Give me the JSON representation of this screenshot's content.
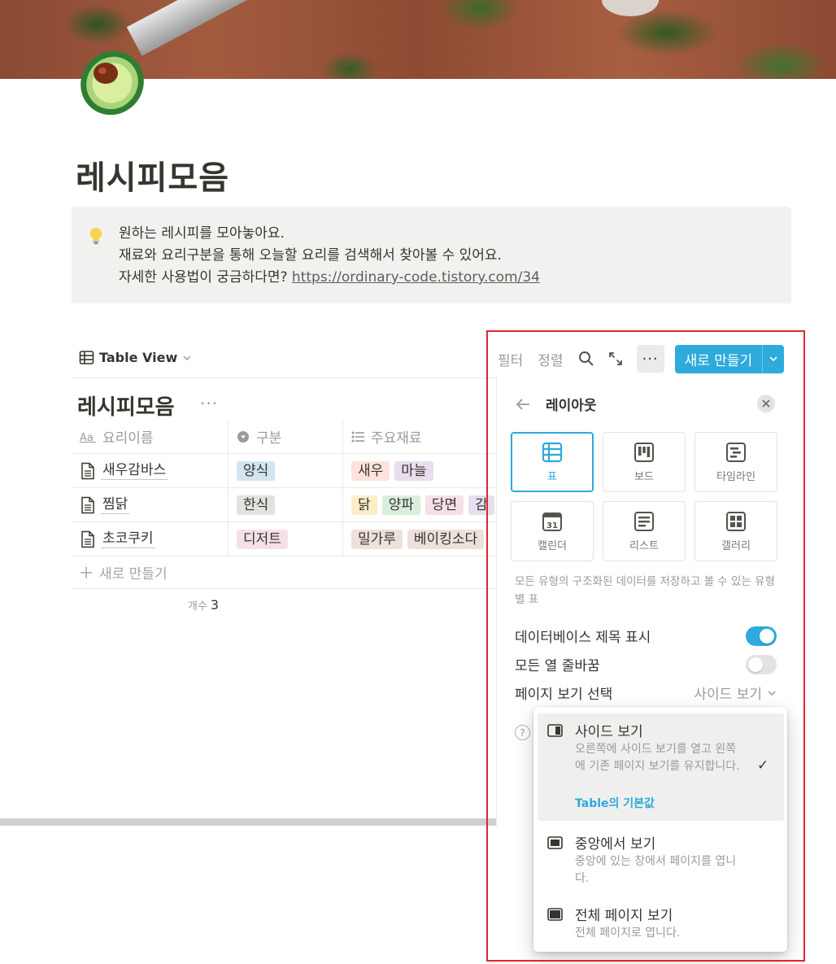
{
  "page": {
    "title": "레시피모음",
    "icon": "avocado-icon",
    "callout": {
      "icon": "lightbulb-icon",
      "line1": "원하는 레시피를 모아놓아요.",
      "line2": "재료와 요리구분을 통해 오늘할 요리를 검색해서 찾아볼 수 있어요.",
      "line3_prefix": "자세한 사용법이 궁금하다면? ",
      "line3_link": "https://ordinary-code.tistory.com/34"
    }
  },
  "view": {
    "name": "Table View",
    "db_title": "레시피모음",
    "more": "···"
  },
  "table": {
    "headers": [
      "요리이름",
      "구분",
      "주요재료"
    ],
    "rows": [
      {
        "name": "새우감바스",
        "category": "양식",
        "ingredients": [
          "새우",
          "마늘"
        ]
      },
      {
        "name": "찜닭",
        "category": "한식",
        "ingredients": [
          "닭",
          "양파",
          "당면",
          "감"
        ]
      },
      {
        "name": "초코쿠키",
        "category": "디저트",
        "ingredients": [
          "밀가루",
          "베이킹소다"
        ]
      }
    ],
    "new_row": "새로 만들기",
    "count_label": "개수",
    "count_value": "3"
  },
  "toolbar": {
    "filter": "필터",
    "sort": "정렬",
    "new_button": "새로 만들기"
  },
  "panel": {
    "title": "레이아웃",
    "layouts": [
      "표",
      "보드",
      "타임라인",
      "캘린더",
      "리스트",
      "갤러리"
    ],
    "active_layout": "표",
    "description": "모든 유형의 구조화된 데이터를 저장하고 볼 수 있는 유형별 표",
    "settings": {
      "show_title_label": "데이터베이스 제목 표시",
      "show_title_on": true,
      "wrap_label": "모든 열 줄바꿈",
      "wrap_on": false,
      "page_view_label": "페이지 보기 선택",
      "page_view_value": "사이드 보기"
    }
  },
  "dropdown": {
    "options": [
      {
        "title": "사이드 보기",
        "desc": "오른쪽에 사이드 보기를 열고 왼쪽에 기존 페이지 보기를 유지합니다.",
        "default": "Table의 기본값",
        "selected": true
      },
      {
        "title": "중앙에서 보기",
        "desc": "중앙에 있는 창에서 페이지를 엽니다.",
        "selected": false
      },
      {
        "title": "전체 페이지 보기",
        "desc": "전체 페이지로 엽니다.",
        "selected": false
      }
    ],
    "checkmark": "✓"
  },
  "colors": {
    "accent": "#2eaadc",
    "highlight_box": "#e0262c",
    "tag_blue": "#d3e5ef",
    "tag_gray": "#e3e2e0",
    "tag_pink": "#f5e0e9",
    "tag_red": "#ffe2dd",
    "tag_purple": "#e8deee",
    "tag_yellow": "#fdecc8",
    "tag_green": "#dbeddb",
    "tag_brown": "#eee0da"
  }
}
